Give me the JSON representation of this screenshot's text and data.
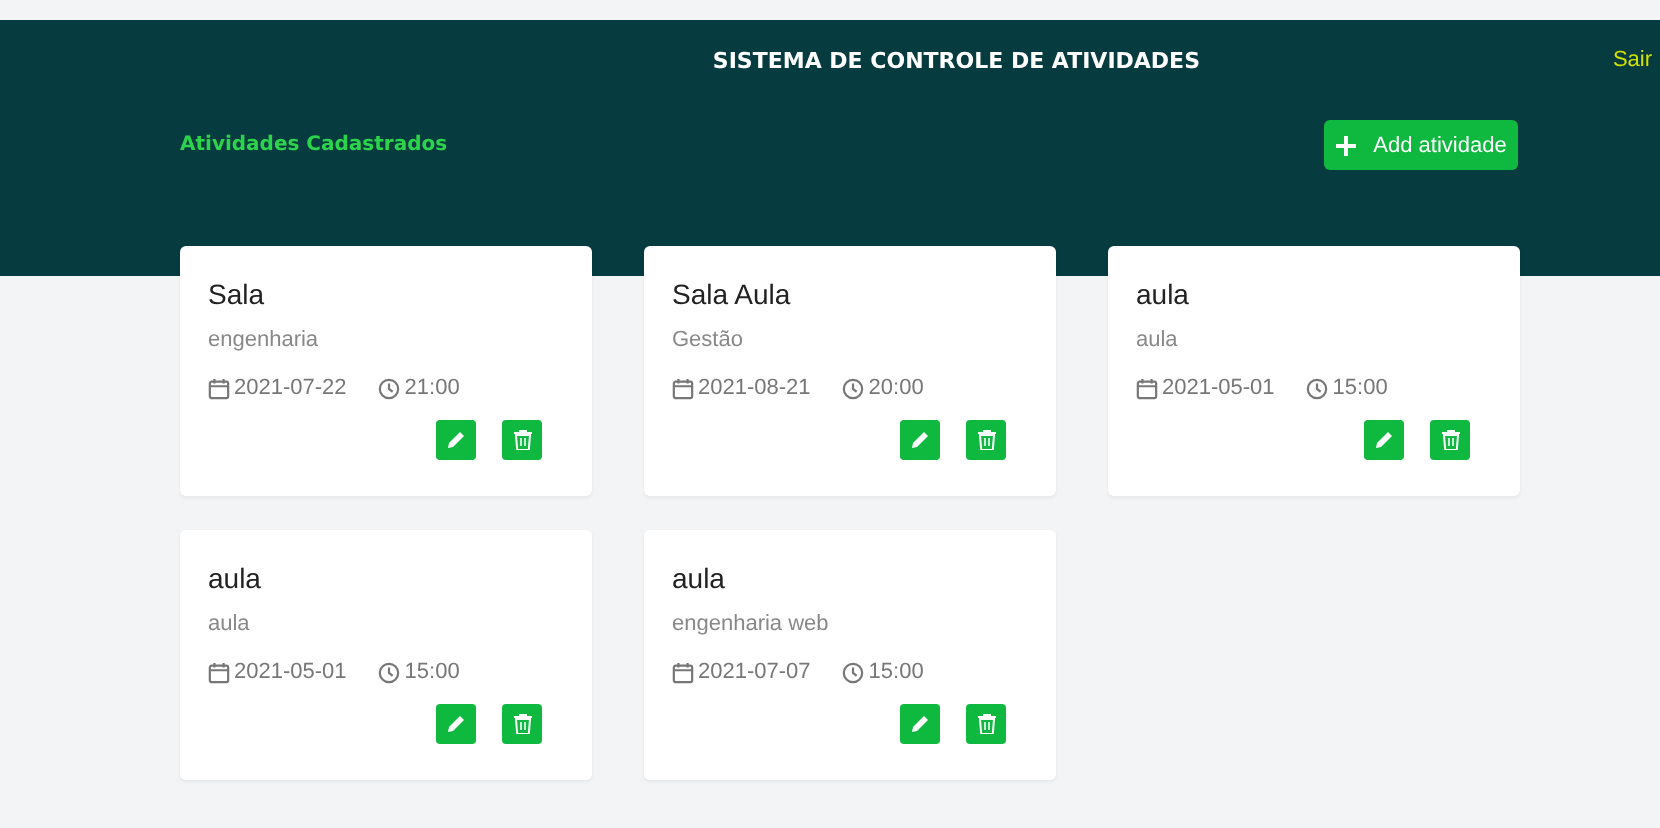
{
  "header": {
    "title": "SISTEMA DE CONTROLE DE ATIVIDADES",
    "logout": "Sair",
    "section_title": "Atividades Cadastrados",
    "add_button": "Add atividade"
  },
  "cards": [
    {
      "title": "Sala",
      "description": "engenharia",
      "date": "2021-07-22",
      "time": "21:00"
    },
    {
      "title": "Sala Aula",
      "description": "Gestão",
      "date": "2021-08-21",
      "time": "20:00"
    },
    {
      "title": "aula",
      "description": "aula",
      "date": "2021-05-01",
      "time": "15:00"
    },
    {
      "title": "aula",
      "description": "aula",
      "date": "2021-05-01",
      "time": "15:00"
    },
    {
      "title": "aula",
      "description": "engenharia web",
      "date": "2021-07-07",
      "time": "15:00"
    }
  ]
}
